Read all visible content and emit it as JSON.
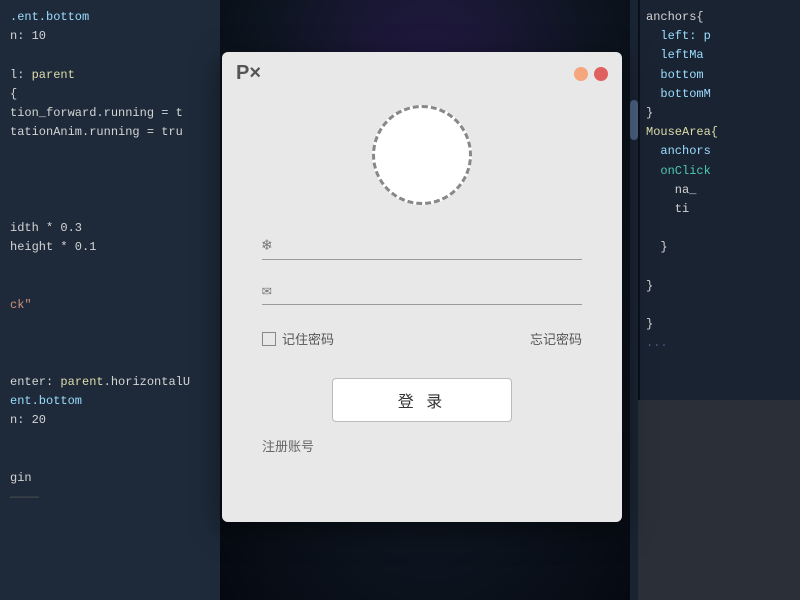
{
  "background": {
    "left_code": [
      {
        "text": ".ent.bottom",
        "color": "code-lightblue"
      },
      {
        "text": "n: 10",
        "color": "code-white"
      },
      {
        "text": "",
        "color": "code-white"
      },
      {
        "text": "l: parent",
        "color": "code-lightblue"
      },
      {
        "text": "{",
        "color": "code-white"
      },
      {
        "text": "tion_forward.running = t",
        "color": "code-white"
      },
      {
        "text": "tationAnim.running = tru",
        "color": "code-white"
      },
      {
        "text": "",
        "color": "code-white"
      },
      {
        "text": "",
        "color": "code-white"
      },
      {
        "text": "",
        "color": "code-white"
      },
      {
        "text": "",
        "color": "code-white"
      },
      {
        "text": "idth * 0.3",
        "color": "code-white"
      },
      {
        "text": "height * 0.1",
        "color": "code-white"
      },
      {
        "text": "",
        "color": "code-white"
      },
      {
        "text": "",
        "color": "code-white"
      },
      {
        "text": "ck\"",
        "color": "code-orange"
      },
      {
        "text": "",
        "color": "code-white"
      },
      {
        "text": "",
        "color": "code-white"
      },
      {
        "text": "",
        "color": "code-white"
      },
      {
        "text": "enter: parent.horizontalU",
        "color": "code-white"
      },
      {
        "text": "ent.bottom",
        "color": "code-lightblue"
      },
      {
        "text": "n: 20",
        "color": "code-white"
      },
      {
        "text": "",
        "color": "code-white"
      },
      {
        "text": "",
        "color": "code-white"
      },
      {
        "text": "gin",
        "color": "code-white"
      }
    ],
    "right_code": [
      {
        "text": "anchors{",
        "color": "code-white"
      },
      {
        "text": "  left: p",
        "color": "code-lightblue"
      },
      {
        "text": "  leftMa",
        "color": "code-lightblue"
      },
      {
        "text": "  bottom",
        "color": "code-lightblue"
      },
      {
        "text": "  bottomM",
        "color": "code-lightblue"
      },
      {
        "text": "}",
        "color": "code-white"
      },
      {
        "text": "MouseArea{",
        "color": "code-yellow"
      },
      {
        "text": "  anchors",
        "color": "code-lightblue"
      },
      {
        "text": "  onClick",
        "color": "code-green"
      },
      {
        "text": "    na_",
        "color": "code-white"
      },
      {
        "text": "    ti",
        "color": "code-white"
      },
      {
        "text": "",
        "color": "code-white"
      },
      {
        "text": "  }",
        "color": "code-white"
      },
      {
        "text": "",
        "color": "code-white"
      },
      {
        "text": "}",
        "color": "code-white"
      },
      {
        "text": "",
        "color": "code-white"
      },
      {
        "text": "}",
        "color": "code-white"
      }
    ]
  },
  "dialog": {
    "logo": "P×",
    "minimize_label": "minimize",
    "close_label": "close",
    "username_placeholder": "",
    "username_icon": "❄",
    "email_icon": "✉",
    "email_placeholder": "",
    "remember_label": "记住密码",
    "forgot_label": "忘记密码",
    "login_button": "登 录",
    "register_label": "注册账号"
  }
}
